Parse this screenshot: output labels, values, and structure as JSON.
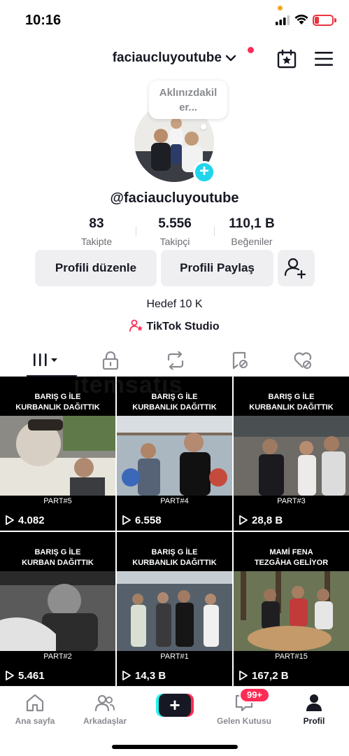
{
  "status": {
    "time": "10:16",
    "battery": "13"
  },
  "header": {
    "username": "faciaucluyoutube"
  },
  "profile": {
    "bubble": "Aklınızdakil er...",
    "handle": "@faciaucluyoutube",
    "stats": [
      {
        "value": "83",
        "label": "Takipte"
      },
      {
        "value": "5.556",
        "label": "Takipçi"
      },
      {
        "value": "110,1 B",
        "label": "Beğeniler"
      }
    ],
    "buttons": {
      "edit": "Profili düzenle",
      "share": "Profili Paylaş"
    },
    "goal": "Hedef 10 K",
    "studio": "TikTok Studio"
  },
  "videos": [
    {
      "title": "BARIŞ G İLE\nKURBANLIK DAĞITTIK",
      "part": "PART#5",
      "views": "4.082"
    },
    {
      "title": "BARIŞ G İLE\nKURBANLIK DAĞITTIK",
      "part": "PART#4",
      "views": "6.558"
    },
    {
      "title": "BARIŞ G İLE\nKURBANLIK DAĞITTIK",
      "part": "PART#3",
      "views": "28,8 B"
    },
    {
      "title": "BARIŞ G İLE\nKURBAN DAĞITTIK",
      "part": "PART#2",
      "views": "5.461"
    },
    {
      "title": "BARIŞ G İLE\nKURBANLIK DAĞITTIK",
      "part": "PART#1",
      "views": "14,3 B"
    },
    {
      "title": "MAMİ FENA\nTEZGÂHA GELİYOR",
      "part": "PART#15",
      "views": "167,2 B"
    }
  ],
  "watermark": "itemsatis",
  "nav": {
    "home": "Ana sayfa",
    "friends": "Arkadaşlar",
    "inbox": "Gelen Kutusu",
    "inbox_badge": "99+",
    "profile": "Profil"
  },
  "colors": {
    "accent": "#fe2c55",
    "cyan": "#20d5ec",
    "text": "#161823"
  }
}
